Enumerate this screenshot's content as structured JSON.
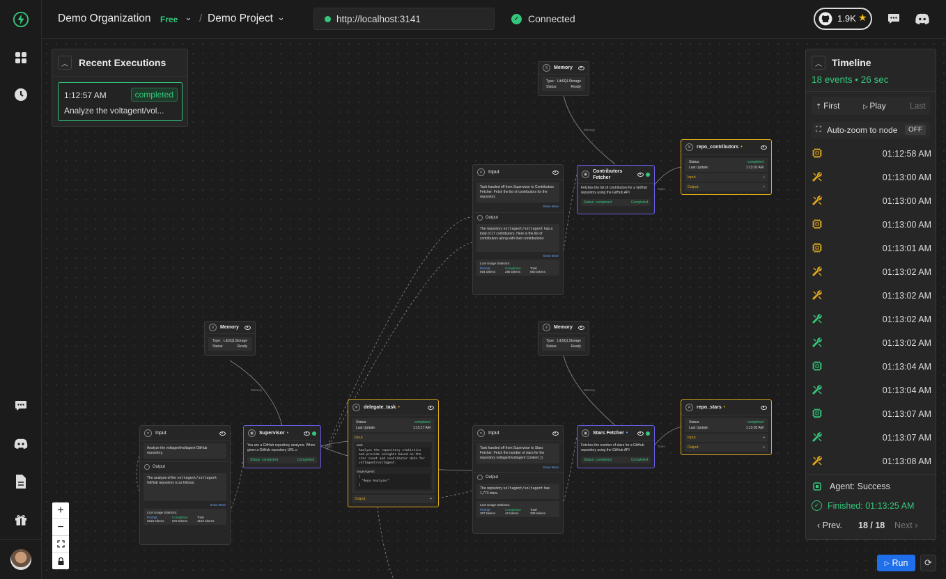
{
  "header": {
    "org_name": "Demo Organization",
    "org_badge": "Free",
    "separator": "/",
    "project_name": "Demo Project",
    "url": "http://localhost:3141",
    "connection_status": "Connected",
    "github_stars": "1.9K"
  },
  "sidebar": {
    "items": [
      {
        "name": "logo",
        "icon": "bolt-icon"
      },
      {
        "name": "dashboard",
        "icon": "grid-icon"
      },
      {
        "name": "history",
        "icon": "clock-icon"
      },
      {
        "name": "chat",
        "icon": "chat-icon"
      },
      {
        "name": "discord",
        "icon": "discord-icon"
      },
      {
        "name": "docs",
        "icon": "document-icon"
      },
      {
        "name": "gift",
        "icon": "gift-icon"
      }
    ]
  },
  "recent_executions": {
    "title": "Recent Executions",
    "item_time": "1:12:57 AM",
    "item_status": "completed",
    "item_text": "Analyze the voltagent/vol..."
  },
  "nodes": {
    "memory_top": {
      "title": "Memory",
      "type_label": "Type:",
      "type_value": "LibSQLStorage",
      "status_label": "Status:",
      "status_value": "Ready",
      "edge_label": "Memory"
    },
    "memory_left": {
      "title": "Memory",
      "type_label": "Type:",
      "type_value": "LibSQLStorage",
      "status_label": "Status:",
      "status_value": "Ready",
      "edge_label": "Memory"
    },
    "memory_mid": {
      "title": "Memory",
      "type_label": "Type:",
      "type_value": "LibSQLStorage",
      "status_label": "Status:",
      "status_value": "Ready",
      "edge_label": "Memory"
    },
    "contrib_io": {
      "input_title": "Input",
      "input_text": "Task handed off from Supervisor to Contributors Fetcher: Fetch the list of contributors for the repository",
      "show_more": "Show More",
      "output_title": "Output",
      "output_text_a": "The repository ",
      "output_code": "voltagent/voltagent",
      "output_text_b": " has a total of 17 contributors. Here is the list of contributors along with their contributions:",
      "output_show_more": "Show More",
      "stats_title": "LLM Usage Statistics:",
      "prompt_label": "Prompt",
      "prompt_value": "694 tokens",
      "completion_label": "Completion",
      "completion_value": "286 tokens",
      "total_label": "Total",
      "total_value": "980 tokens"
    },
    "contrib_agent": {
      "title": "Contributors Fetcher",
      "desc": "Fetches the list of contributors for a GitHub repository using the GitHub API",
      "status": "Status: completed",
      "status_right": "Completed",
      "tools_label": "Tools"
    },
    "repo_contributors": {
      "title": "repo_contributors",
      "status_label": "Status:",
      "status_value": "completed",
      "update_label": "Last Update:",
      "update_value": "1:13:02 AM",
      "input_label": "Input:",
      "output_label": "Output:"
    },
    "supervisor_io": {
      "input_title": "Input",
      "input_text": "Analyze the voltagent/voltagent GitHub repository.",
      "output_title": "Output",
      "output_text_a": "The analysis of the ",
      "output_code": "voltagent/voltagent",
      "output_text_b": " GitHub repository is as follows:",
      "show_more": "Show More",
      "stats_title": "LLM Usage Statistics:",
      "prompt_label": "Prompt",
      "prompt_value": "3618 tokens",
      "completion_label": "Completion",
      "completion_value": "576 tokens",
      "total_label": "Total",
      "total_value": "4194 tokens"
    },
    "supervisor": {
      "title": "Supervisor",
      "desc": "You are a GitHub repository analyzer. When given a GitHub repository URL o",
      "status": "Status: completed",
      "status_right": "Completed",
      "tools_label": "Tools"
    },
    "delegate_task": {
      "title": "delegate_task",
      "status_label": "Status:",
      "status_value": "completed",
      "update_label": "Last Update:",
      "update_value": "1:13:17 AM",
      "input_label": "Input:",
      "task_label": "task:",
      "task_text": "Analyze the repository statistics and provide insights based on the star count and contributor data for voltagent/voltagent.",
      "target_label": "targetAgents:",
      "target_open": "[",
      "target_value": "\"Repo Analyzer\"",
      "target_close": "]",
      "output_label": "Output:"
    },
    "stars_io": {
      "input_title": "Input",
      "input_text": "Task handed off from Supervisor to Stars Fetcher: Fetch the number of stars for the repository voltagent/voltagent Context: {}",
      "show_more": "Show More",
      "output_title": "Output",
      "output_text_a": "The repository ",
      "output_code": "voltagent/voltagent",
      "output_text_b": " has 1,773 stars.",
      "stats_title": "LLM Usage Statistics:",
      "prompt_label": "Prompt",
      "prompt_value": "297 tokens",
      "completion_label": "Completion",
      "completion_value": "42 tokens",
      "total_label": "Total",
      "total_value": "339 tokens"
    },
    "stars_agent": {
      "title": "Stars Fetcher",
      "desc": "Fetches the number of stars for a GitHub repository using the GitHub API",
      "status": "Status: completed",
      "status_right": "Completed",
      "tools_label": "Tools"
    },
    "repo_stars": {
      "title": "repo_stars",
      "status_label": "Status:",
      "status_value": "completed",
      "update_label": "Last Update:",
      "update_value": "1:13:02 AM",
      "input_label": "Input:",
      "output_label": "Output:"
    }
  },
  "timeline": {
    "title": "Timeline",
    "summary": "18 events • 26 sec",
    "first_label": "First",
    "play_label": "Play",
    "last_label": "Last",
    "autozoom_label": "Auto-zoom to node",
    "autozoom_value": "OFF",
    "events": [
      {
        "icon": "chip-icon",
        "color": "#e0a91b",
        "time": "01:12:58 AM"
      },
      {
        "icon": "tool-icon",
        "color": "#e0a91b",
        "time": "01:13:00 AM"
      },
      {
        "icon": "tool-icon",
        "color": "#e0a91b",
        "time": "01:13:00 AM"
      },
      {
        "icon": "chip-icon",
        "color": "#e0a91b",
        "time": "01:13:00 AM"
      },
      {
        "icon": "chip-icon",
        "color": "#e0a91b",
        "time": "01:13:01 AM"
      },
      {
        "icon": "tool-icon",
        "color": "#e0a91b",
        "time": "01:13:02 AM"
      },
      {
        "icon": "tool-icon",
        "color": "#e0a91b",
        "time": "01:13:02 AM"
      },
      {
        "icon": "tool-icon",
        "color": "#34c77b",
        "time": "01:13:02 AM"
      },
      {
        "icon": "tool-icon",
        "color": "#34c77b",
        "time": "01:13:02 AM"
      },
      {
        "icon": "chip-icon",
        "color": "#34c77b",
        "time": "01:13:04 AM"
      },
      {
        "icon": "tool-icon",
        "color": "#34c77b",
        "time": "01:13:04 AM"
      },
      {
        "icon": "chip-icon",
        "color": "#34c77b",
        "time": "01:13:07 AM"
      },
      {
        "icon": "tool-icon",
        "color": "#34c77b",
        "time": "01:13:07 AM"
      },
      {
        "icon": "tool-icon",
        "color": "#e0a91b",
        "time": "01:13:08 AM"
      }
    ],
    "agent_status": "Agent: Success",
    "finished": "Finished: 01:13:25 AM",
    "prev_label": "Prev.",
    "page": "18 / 18",
    "next_label": "Next"
  },
  "controls": {
    "zoom_in": "+",
    "zoom_out": "−",
    "run_label": "Run"
  },
  "colors": {
    "accent_green": "#34c77b",
    "accent_gold": "#e0a91b",
    "accent_blue": "#6a5ff0",
    "run_blue": "#1f6feb"
  }
}
